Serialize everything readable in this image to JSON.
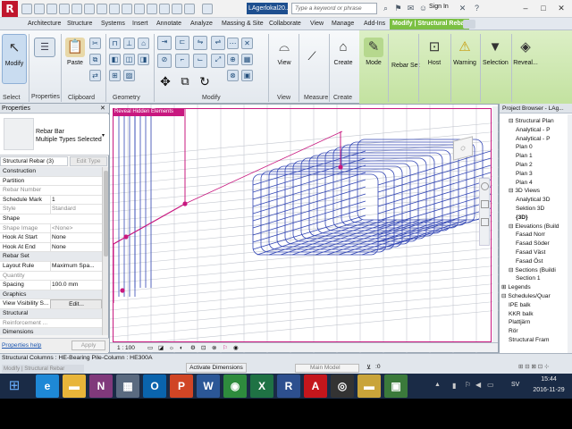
{
  "app": {
    "logo_letter": "R",
    "doc_title": "LAgerlokal20..."
  },
  "search": {
    "placeholder": "Type a keyword or phrase"
  },
  "user": {
    "sign_in": "Sign In"
  },
  "tabs": [
    "Architecture",
    "Structure",
    "Systems",
    "Insert",
    "Annotate",
    "Analyze",
    "Massing & Site",
    "Collaborate",
    "View",
    "Manage",
    "Add-Ins",
    "Modify | Structural Rebar"
  ],
  "ribbon": {
    "modify": "Modify",
    "paste": "Paste",
    "properties": "Properties",
    "view": "View",
    "measure": "Measure",
    "create": "Create",
    "mode": "Mode",
    "rebar_set": "Rebar Set",
    "host": "Host",
    "warning": "Warning",
    "selection": "Selection",
    "reveal": "Reveal...",
    "panels": {
      "select": "Select",
      "properties": "Properties",
      "clipboard": "Clipboard",
      "geometry": "Geometry",
      "modify": "Modify",
      "view": "View",
      "measure": "Measure",
      "create": "Create"
    }
  },
  "properties": {
    "title": "Properties",
    "type_line1": "Rebar Bar",
    "type_line2": "Multiple Types Selected",
    "filter": "Structural Rebar (3)",
    "edit_type": "Edit Type",
    "rows": [
      {
        "k": "Construction",
        "v": "",
        "cat": true
      },
      {
        "k": "Partition",
        "v": ""
      },
      {
        "k": "Rebar Number",
        "v": "",
        "dim": true
      },
      {
        "k": "Schedule Mark",
        "v": "1"
      },
      {
        "k": "Style",
        "v": "Standard",
        "dim": true
      },
      {
        "k": "Shape",
        "v": ""
      },
      {
        "k": "Shape Image",
        "v": "<None>",
        "dim": true
      },
      {
        "k": "Hook At Start",
        "v": "None"
      },
      {
        "k": "Hook At End",
        "v": "None"
      },
      {
        "k": "Rebar Set",
        "v": "",
        "cat": true
      },
      {
        "k": "Layout Rule",
        "v": "Maximum Spa..."
      },
      {
        "k": "Quantity",
        "v": "",
        "dim": true
      },
      {
        "k": "Spacing",
        "v": "100.0 mm"
      },
      {
        "k": "Graphics",
        "v": "",
        "cat": true
      },
      {
        "k": "View Visibility S...",
        "v": "Edit..."
      },
      {
        "k": "Structural",
        "v": "",
        "cat": true
      },
      {
        "k": "Reinforcement ...",
        "v": "",
        "dim": true
      },
      {
        "k": "Dimensions",
        "v": "",
        "cat": true
      }
    ],
    "help": "Properties help",
    "apply": "Apply"
  },
  "view": {
    "tag": "Reveal Hidden Elements",
    "scale": "1 : 100"
  },
  "browser": {
    "title": "Project Browser - LAg...",
    "items": [
      {
        "t": "Structural Plan",
        "lvl": 1,
        "exp": "−"
      },
      {
        "t": "Analytical - P",
        "lvl": 2
      },
      {
        "t": "Analytical - P",
        "lvl": 2
      },
      {
        "t": "Plan 0",
        "lvl": 2
      },
      {
        "t": "Plan 1",
        "lvl": 2
      },
      {
        "t": "Plan 2",
        "lvl": 2
      },
      {
        "t": "Plan 3",
        "lvl": 2
      },
      {
        "t": "Plan 4",
        "lvl": 2
      },
      {
        "t": "3D Views",
        "lvl": 1,
        "exp": "−"
      },
      {
        "t": "Analytical 3D",
        "lvl": 2
      },
      {
        "t": "Sektion 3D",
        "lvl": 2
      },
      {
        "t": "{3D}",
        "lvl": 2,
        "bold": true
      },
      {
        "t": "Elevations (Build",
        "lvl": 1,
        "exp": "−"
      },
      {
        "t": "Fasad Norr",
        "lvl": 2
      },
      {
        "t": "Fasad Söder",
        "lvl": 2
      },
      {
        "t": "Fasad Väst",
        "lvl": 2
      },
      {
        "t": "Fasad Öst",
        "lvl": 2
      },
      {
        "t": "Sections (Buildi",
        "lvl": 1,
        "exp": "−"
      },
      {
        "t": "Section 1",
        "lvl": 2
      },
      {
        "t": "Legends",
        "lvl": 0,
        "exp": "+"
      },
      {
        "t": "Schedules/Quar",
        "lvl": 0,
        "exp": "−"
      },
      {
        "t": "IPE balk",
        "lvl": 1
      },
      {
        "t": "KKR balk",
        "lvl": 1
      },
      {
        "t": "Plattjärn",
        "lvl": 1
      },
      {
        "t": "Rör",
        "lvl": 1
      },
      {
        "t": "Structural Fram",
        "lvl": 1
      }
    ]
  },
  "status": {
    "main": "Structural Columns : HE-Bearing Pile-Column : HE300A",
    "hint": "Modify | Structural Rebar",
    "activate": "Activate Dimensions",
    "main_model": "Main Model",
    "zero": ":0"
  },
  "taskbar": {
    "lang": "SV",
    "time": "15:44",
    "date": "2016-11-29",
    "apps": [
      {
        "name": "internet-explorer",
        "g": "e",
        "c": "#1e88d6"
      },
      {
        "name": "file-explorer",
        "g": "▬",
        "c": "#e8b53a"
      },
      {
        "name": "onenote",
        "g": "N",
        "c": "#80397b"
      },
      {
        "name": "calculator",
        "g": "▦",
        "c": "#5a6a80"
      },
      {
        "name": "outlook",
        "g": "O",
        "c": "#0a64ad"
      },
      {
        "name": "powerpoint",
        "g": "P",
        "c": "#d04525"
      },
      {
        "name": "word",
        "g": "W",
        "c": "#2b5797"
      },
      {
        "name": "chrome",
        "g": "◉",
        "c": "#2e8b3d"
      },
      {
        "name": "excel",
        "g": "X",
        "c": "#1f7244"
      },
      {
        "name": "revit",
        "g": "R",
        "c": "#2d4f8e"
      },
      {
        "name": "adobe",
        "g": "A",
        "c": "#c4161c"
      },
      {
        "name": "obs",
        "g": "◎",
        "c": "#333333"
      },
      {
        "name": "folder",
        "g": "▬",
        "c": "#c9a43a"
      },
      {
        "name": "photos",
        "g": "▣",
        "c": "#3b7a3b"
      }
    ]
  },
  "colors": {
    "accent": "#7bc043",
    "view_frame": "#c8187f",
    "rebar": "#3246b4",
    "grid": "#b0b6c0"
  }
}
